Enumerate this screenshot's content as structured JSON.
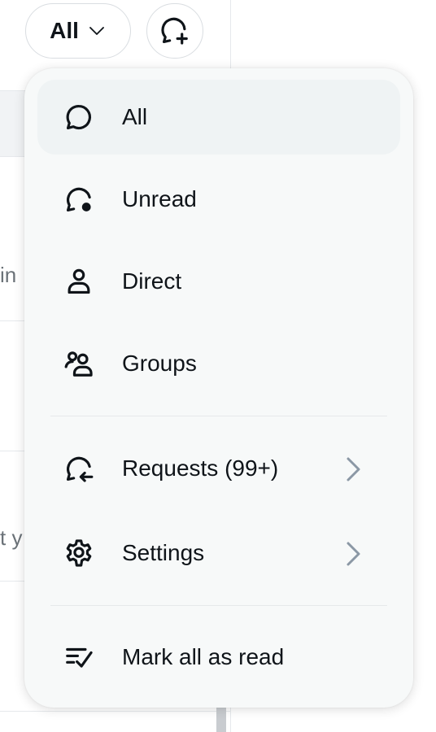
{
  "filter_button": {
    "label": "All"
  },
  "background": {
    "clip_1": "in",
    "clip_2": "t y"
  },
  "menu": {
    "items": [
      {
        "label": "All",
        "icon": "chat-bubble-icon",
        "selected": true
      },
      {
        "label": "Unread",
        "icon": "chat-bubble-unread-icon"
      },
      {
        "label": "Direct",
        "icon": "person-icon"
      },
      {
        "label": "Groups",
        "icon": "people-icon"
      },
      {
        "label": "Requests (99+)",
        "icon": "chat-bubble-arrow-icon",
        "has_submenu": true
      },
      {
        "label": "Settings",
        "icon": "gear-icon",
        "has_submenu": true
      },
      {
        "label": "Mark all as read",
        "icon": "mark-read-icon"
      }
    ]
  },
  "colors": {
    "menu_bg": "#f7f9f9",
    "selected_bg": "#eff3f4",
    "text": "#0f1419",
    "chevron": "#8b98a5"
  }
}
